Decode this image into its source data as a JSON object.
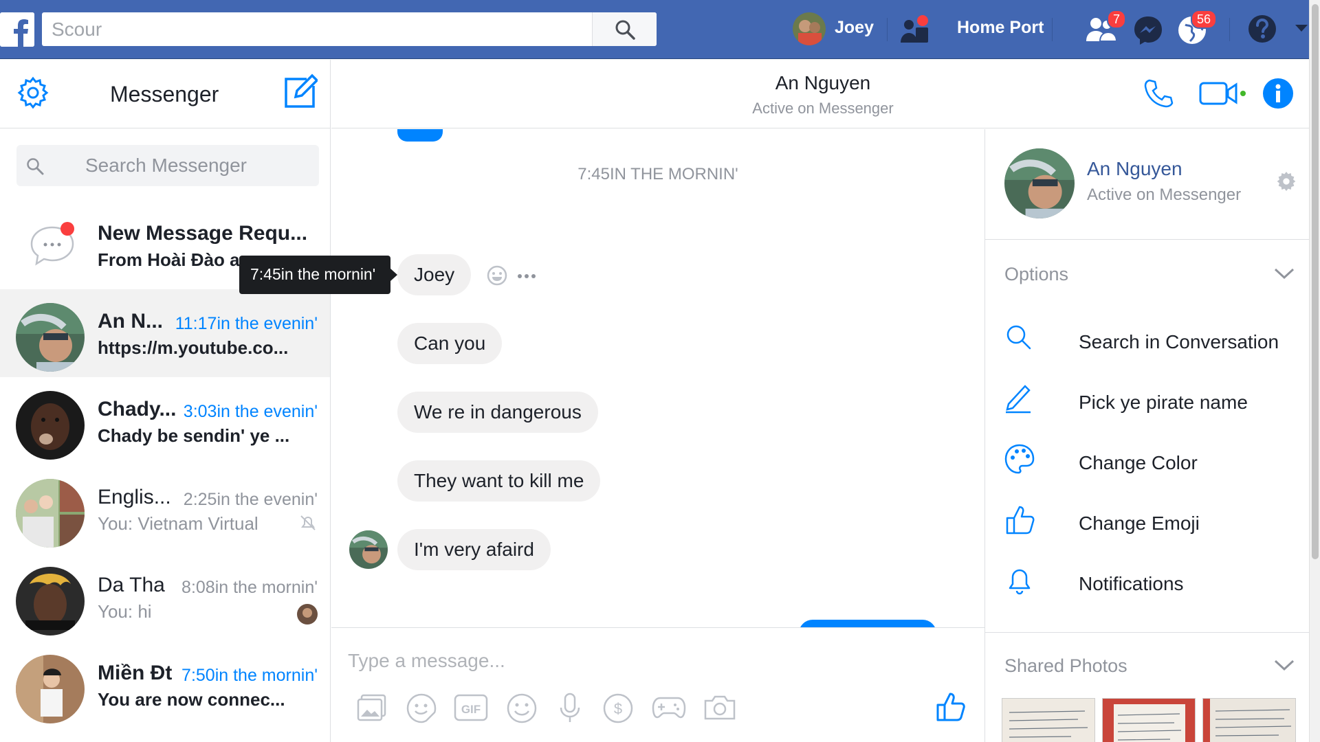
{
  "topbar": {
    "search_placeholder": "Scour",
    "user_name": "Joey",
    "home_label": "Home Port",
    "friend_requests_count": "7",
    "notifications_count": "56"
  },
  "left": {
    "title": "Messenger",
    "search_placeholder": "Search Messenger",
    "conversations": [
      {
        "name": "New Message Requ...",
        "snippet": "From Hoài Đào a",
        "time": ""
      },
      {
        "name": "An N...",
        "time": "11:17in the evenin'",
        "snippet": "https://m.youtube.co..."
      },
      {
        "name": "Chady...",
        "time": "3:03in the evenin'",
        "snippet": "Chady be sendin' ye ..."
      },
      {
        "name": "Englis...",
        "time": "2:25in the evenin'",
        "snippet": "You: Vietnam Virtual"
      },
      {
        "name": "Da Tha",
        "time": "8:08in the mornin'",
        "snippet": "You: hi"
      },
      {
        "name": "Miền Đt",
        "time": "7:50in the mornin'",
        "snippet": "You are now connec..."
      }
    ],
    "tooltip": "7:45in the mornin'"
  },
  "chat": {
    "name": "An Nguyen",
    "status": "Active on Messenger",
    "timestamp": "7:45IN THE MORNIN'",
    "messages": [
      "Joey",
      "Can you",
      "We re in dangerous",
      "They want to kill me",
      "I'm very afaird"
    ],
    "composer_placeholder": "Type a message..."
  },
  "right": {
    "profile_name": "An Nguyen",
    "profile_status": "Active on Messenger",
    "options_title": "Options",
    "options": [
      "Search in Conversation",
      "Pick ye pirate name",
      "Change Color",
      "Change Emoji",
      "Notifications"
    ],
    "shared_photos_title": "Shared Photos"
  },
  "colors": {
    "brand": "#4267b2",
    "accent": "#0084ff",
    "badge": "#fa3e3e"
  }
}
